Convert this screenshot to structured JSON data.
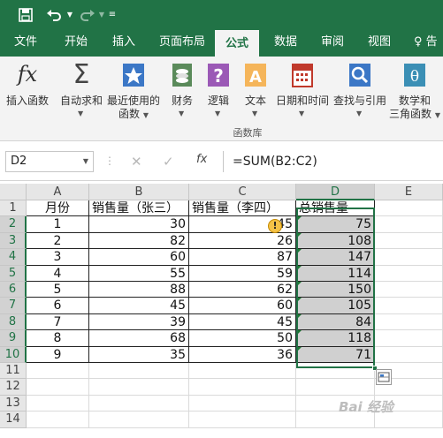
{
  "quick_access": {
    "save_icon": "save-icon",
    "undo_icon": "undo-icon",
    "redo_icon": "redo-icon",
    "customize_icon": "customize-qat-icon"
  },
  "tabs": [
    "文件",
    "开始",
    "插入",
    "页面布局",
    "公式",
    "数据",
    "审阅",
    "视图"
  ],
  "active_tab": "公式",
  "tell_me": "告",
  "ribbon": {
    "buttons": [
      {
        "label": "插入函数",
        "label2": "",
        "icon": "fx-icon"
      },
      {
        "label": "自动求和",
        "label2": "",
        "icon": "sigma-icon"
      },
      {
        "label": "最近使用的",
        "label2": "函数",
        "icon": "recent-star-icon"
      },
      {
        "label": "财务",
        "label2": "",
        "icon": "finance-icon"
      },
      {
        "label": "逻辑",
        "label2": "",
        "icon": "logic-icon"
      },
      {
        "label": "文本",
        "label2": "",
        "icon": "text-icon"
      },
      {
        "label": "日期和时间",
        "label2": "",
        "icon": "calendar-icon"
      },
      {
        "label": "查找与引用",
        "label2": "",
        "icon": "lookup-icon"
      },
      {
        "label": "数学和",
        "label2": "三角函数",
        "icon": "math-icon"
      }
    ],
    "group_label": "函数库"
  },
  "formula_bar": {
    "name_box": "D2",
    "fx_label": "fx",
    "formula": "=SUM(B2:C2)"
  },
  "sheet": {
    "columns": [
      "A",
      "B",
      "C",
      "D",
      "E"
    ],
    "rows": [
      "1",
      "2",
      "3",
      "4",
      "5",
      "6",
      "7",
      "8",
      "9",
      "10",
      "11",
      "12",
      "13",
      "14"
    ],
    "headers": [
      "月份",
      "销售量（张三）",
      "销售量（李四）",
      "总销售量"
    ],
    "data": [
      [
        "1",
        "30",
        "45",
        "75"
      ],
      [
        "2",
        "82",
        "26",
        "108"
      ],
      [
        "3",
        "60",
        "87",
        "147"
      ],
      [
        "4",
        "55",
        "59",
        "114"
      ],
      [
        "5",
        "88",
        "62",
        "150"
      ],
      [
        "6",
        "45",
        "60",
        "105"
      ],
      [
        "7",
        "39",
        "45",
        "84"
      ],
      [
        "8",
        "68",
        "50",
        "118"
      ],
      [
        "9",
        "35",
        "36",
        "71"
      ]
    ]
  },
  "watermark": "Bai 经验",
  "colors": {
    "brand": "#217346",
    "selection": "#d0d0d0"
  }
}
